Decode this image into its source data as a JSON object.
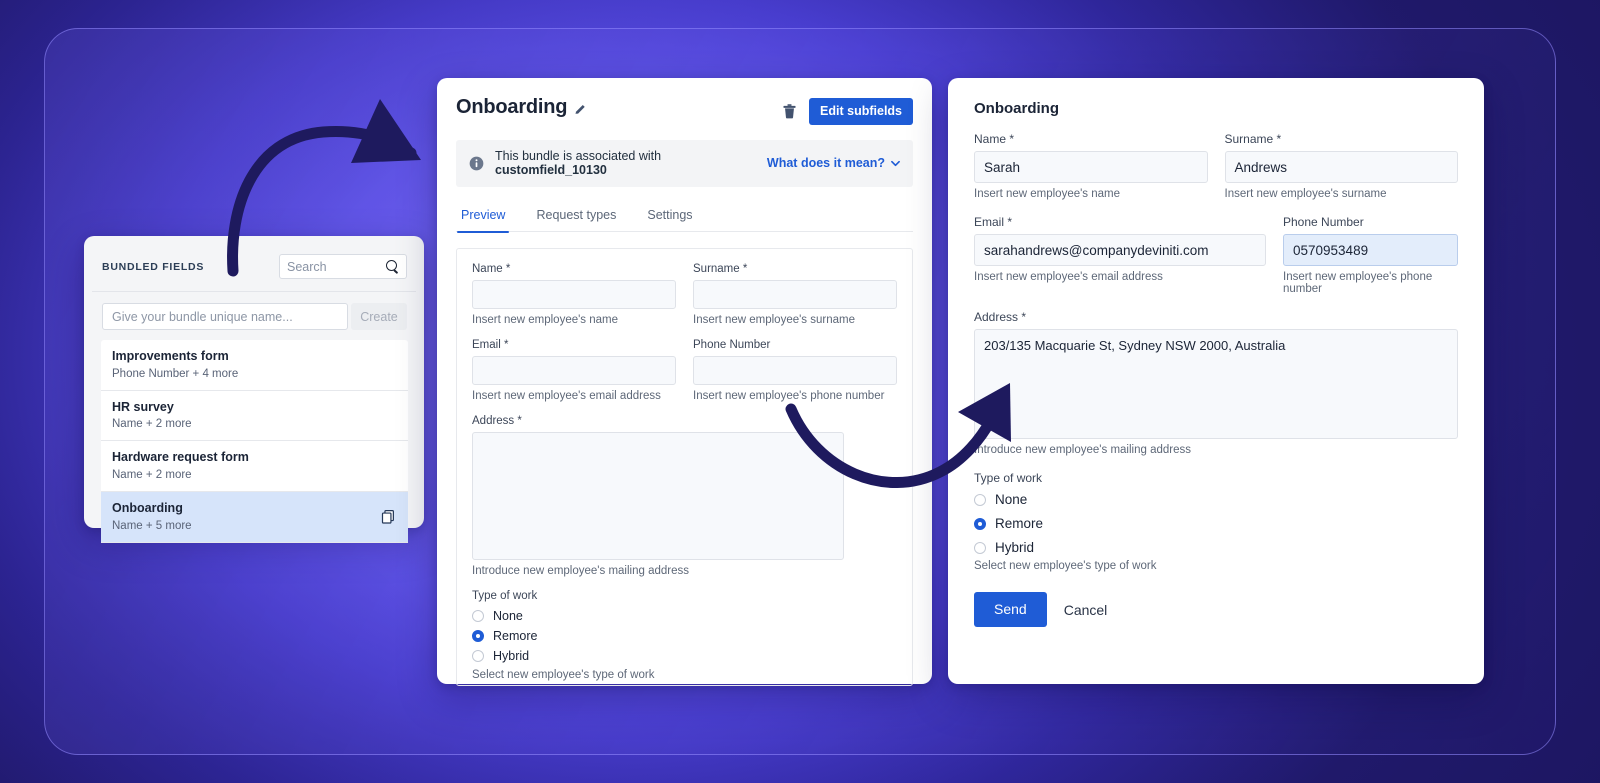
{
  "colors": {
    "accent_blue": "#1f5cd6",
    "selected_row": "#d6e4fa",
    "arrow_navy": "#1e1a5e",
    "bg_purple": "#6257e8",
    "bg_deep": "#241d78"
  },
  "left_panel": {
    "header_title": "BUNDLED FIELDS",
    "search": {
      "placeholder": "Search",
      "icon": "search-icon"
    },
    "create_input": {
      "placeholder": "Give your bundle unique name...",
      "value": ""
    },
    "create_label": "Create",
    "bundles": [
      {
        "name": "Improvements form",
        "summary": "Phone Number + 4 more",
        "selected": false
      },
      {
        "name": "HR survey",
        "summary": "Name + 2 more",
        "selected": false
      },
      {
        "name": "Hardware request form",
        "summary": "Name + 2 more",
        "selected": false
      },
      {
        "name": "Onboarding",
        "summary": "Name + 5 more",
        "selected": true
      }
    ]
  },
  "middle_panel": {
    "title": "Onboarding",
    "edit_icon": "pencil-icon",
    "delete_icon": "trash-icon",
    "edit_subfields_label": "Edit subfields",
    "banner": {
      "icon": "info-icon",
      "text_prefix": "This bundle is associated with ",
      "text_bold": "customfield_10130",
      "link_label": "What does it mean?",
      "link_icon": "chevron-down-icon"
    },
    "tabs": [
      {
        "label": "Preview",
        "active": true
      },
      {
        "label": "Request types",
        "active": false
      },
      {
        "label": "Settings",
        "active": false
      }
    ],
    "form": {
      "name": {
        "label": "Name",
        "required": "*",
        "value": "",
        "hint": "Insert new employee's name"
      },
      "surname": {
        "label": "Surname",
        "required": "*",
        "value": "",
        "hint": "Insert new employee's surname"
      },
      "email": {
        "label": "Email",
        "required": "*",
        "value": "",
        "hint": "Insert new employee's email address"
      },
      "phone": {
        "label": "Phone Number",
        "required": "",
        "value": "",
        "hint": "Insert new employee's phone number"
      },
      "address": {
        "label": "Address",
        "required": "*",
        "value": "",
        "hint": "Introduce new employee's mailing address"
      },
      "type_of_work": {
        "label": "Type of work",
        "hint": "Select new employee's type of work",
        "options": [
          {
            "label": "None",
            "selected": false
          },
          {
            "label": "Remore",
            "selected": true
          },
          {
            "label": "Hybrid",
            "selected": false
          }
        ]
      }
    }
  },
  "right_panel": {
    "title": "Onboarding",
    "form": {
      "name": {
        "label": "Name",
        "required": "*",
        "value": "Sarah",
        "hint": "Insert new employee's name"
      },
      "surname": {
        "label": "Surname",
        "required": "*",
        "value": "Andrews",
        "hint": "Insert new employee's surname"
      },
      "email": {
        "label": "Email",
        "required": "*",
        "value": "sarahandrews@companydeviniti.com",
        "hint": "Insert new employee's email address"
      },
      "phone": {
        "label": "Phone Number",
        "required": "",
        "value": "0570953489",
        "hint": "Insert new employee's phone number",
        "focused": true
      },
      "address": {
        "label": "Address",
        "required": "*",
        "value": "203/135 Macquarie St, Sydney NSW 2000, Australia",
        "hint": "Introduce new employee's mailing address"
      },
      "type_of_work": {
        "label": "Type of work",
        "hint": "Select new employee's type of work",
        "options": [
          {
            "label": "None",
            "selected": false
          },
          {
            "label": "Remore",
            "selected": true
          },
          {
            "label": "Hybrid",
            "selected": false
          }
        ]
      }
    },
    "send_label": "Send",
    "cancel_label": "Cancel"
  },
  "annotations": {
    "arrow_1": "curved-arrow-pointing-right",
    "arrow_2": "curved-arrow-pointing-up-right"
  }
}
